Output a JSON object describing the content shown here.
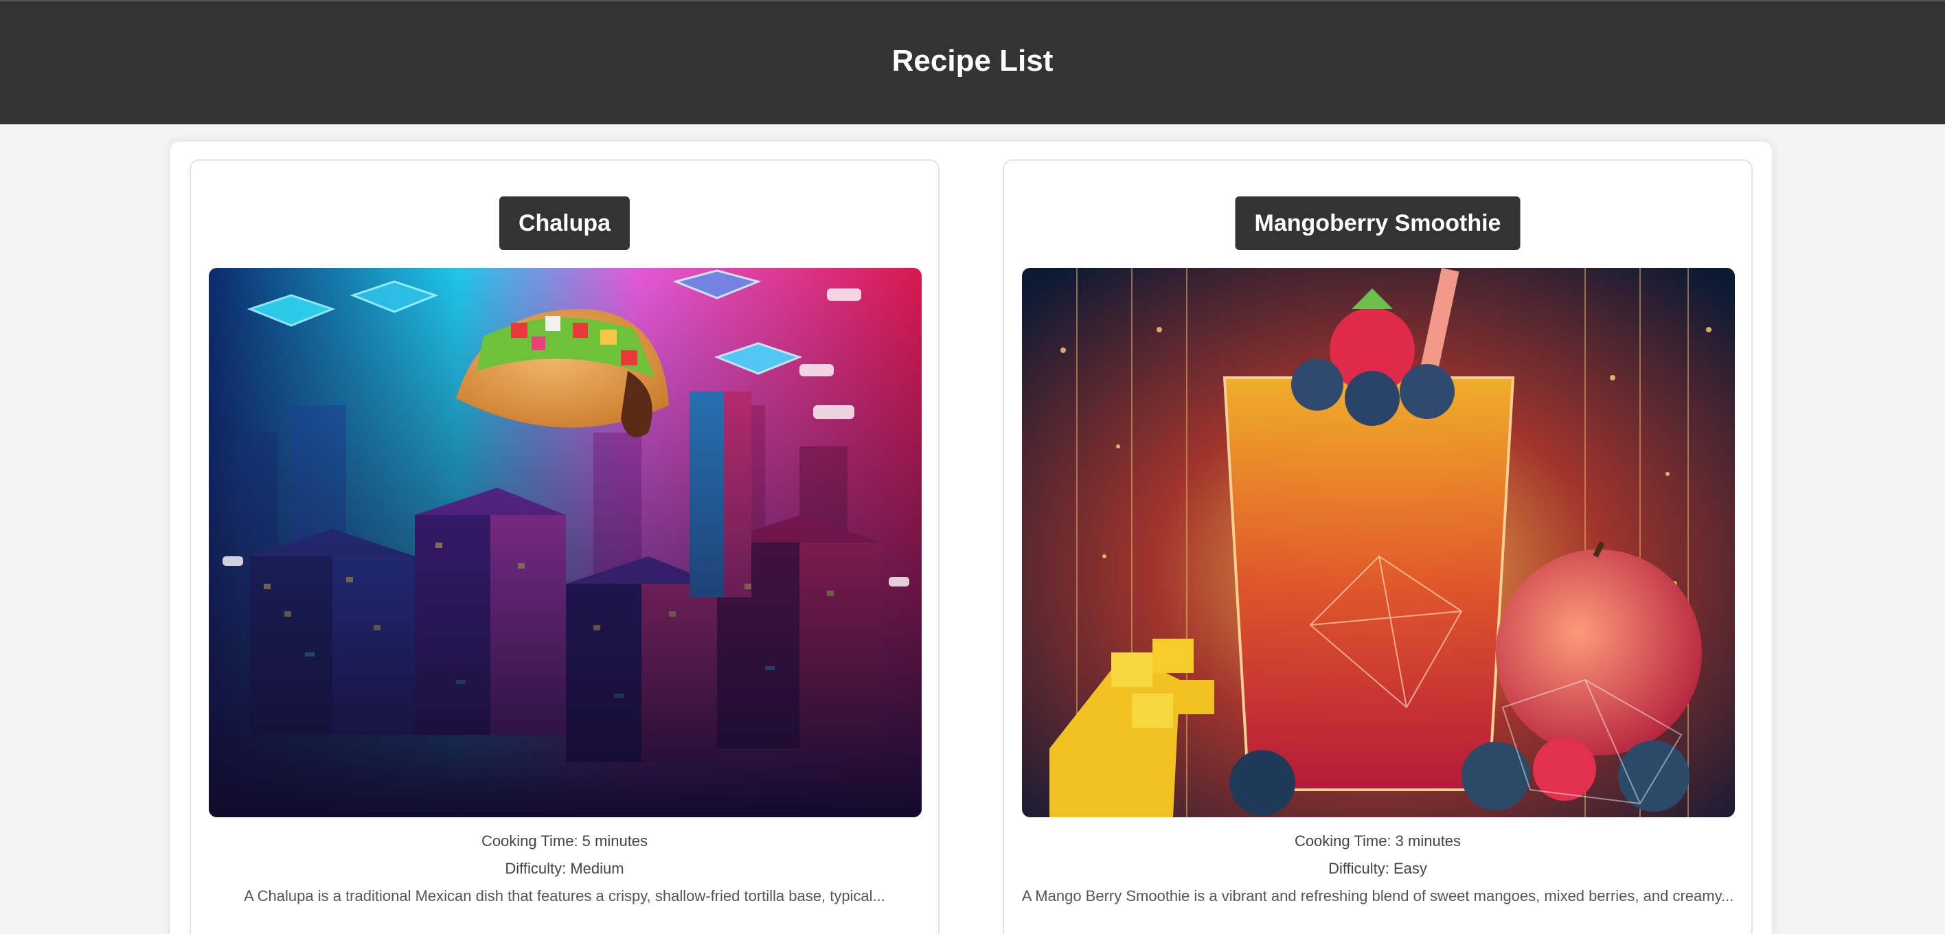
{
  "page": {
    "title": "Recipe List"
  },
  "recipes": [
    {
      "name": "Chalupa",
      "cooking_time": "Cooking Time: 5 minutes",
      "difficulty": "Difficulty: Medium",
      "description": "A Chalupa is a traditional Mexican dish that features a crispy, shallow-fried tortilla base, typical..."
    },
    {
      "name": "Mangoberry Smoothie",
      "cooking_time": "Cooking Time: 3 minutes",
      "difficulty": "Difficulty: Easy",
      "description": "A Mango Berry Smoothie is a vibrant and refreshing blend of sweet mangoes, mixed berries, and creamy..."
    }
  ],
  "colors": {
    "header_bg": "#333333",
    "page_bg": "#f4f4f4",
    "badge_bg": "#333333",
    "text": "#444444"
  }
}
